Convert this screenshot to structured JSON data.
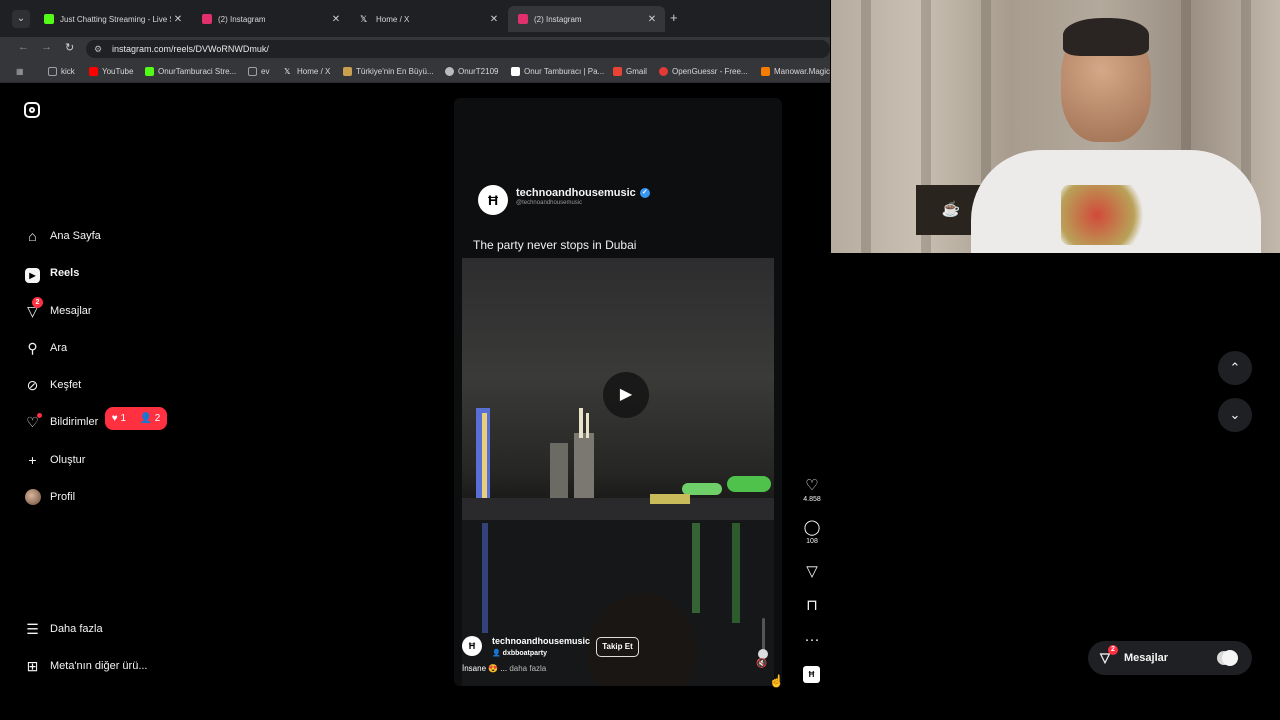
{
  "browser": {
    "tabs": [
      {
        "title": "Just Chatting Streaming - Live S",
        "favicon_color": "#53fc18"
      },
      {
        "title": "(2) Instagram",
        "favicon_color": "#e1306c"
      },
      {
        "title": "Home / X",
        "favicon_color": "#ffffff"
      },
      {
        "title": "(2) Instagram",
        "favicon_color": "#e1306c"
      }
    ],
    "url": "instagram.com/reels/DVWoRNWDmuk/",
    "bookmarks": [
      {
        "label": "kick",
        "color": "#9aa0a6"
      },
      {
        "label": "YouTube",
        "color": "#ff0000"
      },
      {
        "label": "OnurTamburaci Stre...",
        "color": "#53fc18"
      },
      {
        "label": "ev",
        "color": "#9aa0a6"
      },
      {
        "label": "Home / X",
        "color": "#ffffff"
      },
      {
        "label": "Türkiye'nin En Büyü...",
        "color": "#c8a050"
      },
      {
        "label": "OnurT2109",
        "color": "#bbbbbb"
      },
      {
        "label": "Onur Tamburacı | Pa...",
        "color": "#ffffff"
      },
      {
        "label": "Gmail",
        "color": "#ea4335"
      },
      {
        "label": "OpenGuessr - Free...",
        "color": "#e53935"
      },
      {
        "label": "Manowar.Magic",
        "color": "#f57c00"
      }
    ]
  },
  "sidebar": {
    "items": [
      {
        "label": "Ana Sayfa",
        "icon": "home-icon"
      },
      {
        "label": "Reels",
        "icon": "reels-icon"
      },
      {
        "label": "Mesajlar",
        "icon": "messages-icon",
        "badge": "2"
      },
      {
        "label": "Ara",
        "icon": "search-icon"
      },
      {
        "label": "Keşfet",
        "icon": "explore-icon"
      },
      {
        "label": "Bildirimler",
        "icon": "heart-icon"
      },
      {
        "label": "Oluştur",
        "icon": "plus-icon"
      },
      {
        "label": "Profil",
        "icon": "avatar"
      }
    ],
    "notifications_pill": {
      "likes": "1",
      "follows": "2"
    },
    "more": "Daha fazla",
    "meta": "Meta'nın diğer ürü..."
  },
  "reel": {
    "username": "technoandhousemusic",
    "handle": "@technoandhousemusic",
    "caption": "The party never stops in Dubai",
    "author": "technoandhousemusic",
    "collab": "dxbboatparty",
    "follow": "Takip Et",
    "description": "İnsane 😍 ...",
    "more": "daha fazla",
    "likes": "4.858",
    "comments": "108"
  },
  "messages_pill": {
    "label": "Mesajlar",
    "badge": "2"
  },
  "colors": {
    "accent_red": "#ff3040",
    "verified_blue": "#3897f0"
  }
}
